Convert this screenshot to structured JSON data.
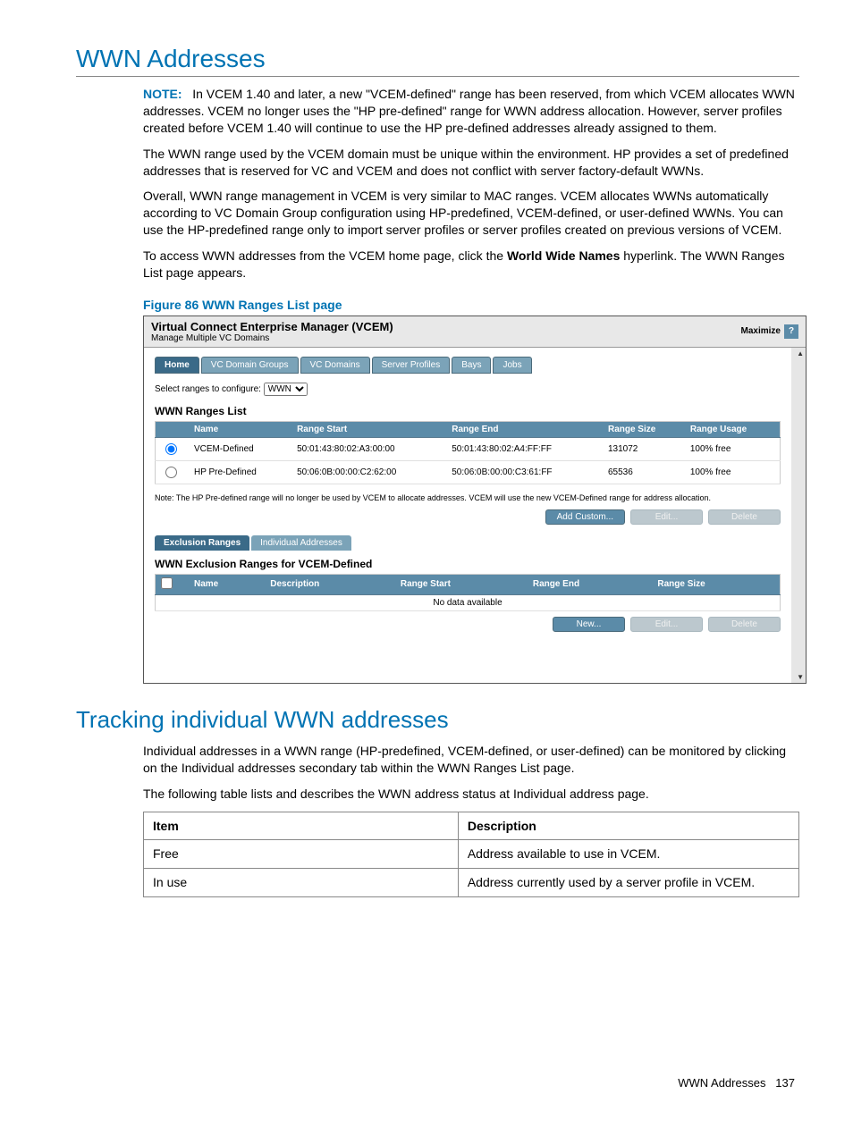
{
  "h1": "WWN Addresses",
  "note_label": "NOTE:",
  "para1": "In VCEM 1.40 and later, a new \"VCEM-defined\" range has been reserved, from which VCEM allocates WWN addresses. VCEM no longer uses the \"HP pre-defined\" range for WWN address allocation. However, server profiles created before VCEM 1.40 will continue to use the HP pre-defined addresses already assigned to them.",
  "para2": "The WWN range used by the VCEM domain must be unique within the environment. HP provides a set of predefined addresses that is reserved for VC and VCEM and does not conflict with server factory-default WWNs.",
  "para3": "Overall, WWN range management in VCEM is very similar to MAC ranges. VCEM allocates WWNs automatically according to VC Domain Group configuration using HP-predefined, VCEM-defined, or user-defined WWNs. You can use the HP-predefined range only to import server profiles or server profiles created on previous versions of VCEM.",
  "para4_a": "To access WWN addresses from the VCEM home page, click the ",
  "para4_bold": "World Wide Names",
  "para4_b": " hyperlink. The WWN Ranges List page appears.",
  "fig_caption": "Figure 86 WWN Ranges List page",
  "ss": {
    "title": "Virtual Connect Enterprise Manager (VCEM)",
    "subtitle": "Manage Multiple VC Domains",
    "maximize": "Maximize",
    "help": "?",
    "tabs": [
      "Home",
      "VC Domain Groups",
      "VC Domains",
      "Server Profiles",
      "Bays",
      "Jobs"
    ],
    "select_label": "Select ranges to configure:",
    "select_value": "WWN",
    "list_title": "WWN Ranges List",
    "cols": [
      "",
      "Name",
      "Range Start",
      "Range End",
      "Range Size",
      "Range Usage"
    ],
    "rows": [
      {
        "sel": true,
        "name": "VCEM-Defined",
        "start": "50:01:43:80:02:A3:00:00",
        "end": "50:01:43:80:02:A4:FF:FF",
        "size": "131072",
        "usage": "100% free"
      },
      {
        "sel": false,
        "name": "HP Pre-Defined",
        "start": "50:06:0B:00:00:C2:62:00",
        "end": "50:06:0B:00:00:C3:61:FF",
        "size": "65536",
        "usage": "100% free"
      }
    ],
    "note": "Note: The HP Pre-defined range will no longer be used by VCEM to allocate addresses. VCEM will use the new VCEM-Defined range for address allocation.",
    "btns1": [
      {
        "label": "Add Custom...",
        "enabled": true
      },
      {
        "label": "Edit...",
        "enabled": false
      },
      {
        "label": "Delete",
        "enabled": false
      }
    ],
    "subtabs": [
      "Exclusion Ranges",
      "Individual Addresses"
    ],
    "ex_title": "WWN Exclusion Ranges for VCEM-Defined",
    "ex_cols": [
      "",
      "Name",
      "Description",
      "Range Start",
      "Range End",
      "Range Size"
    ],
    "no_data": "No data available",
    "btns2": [
      {
        "label": "New...",
        "enabled": true
      },
      {
        "label": "Edit...",
        "enabled": false
      },
      {
        "label": "Delete",
        "enabled": false
      }
    ]
  },
  "h2": "Tracking individual WWN addresses",
  "para5": "Individual addresses in a WWN range (HP-predefined, VCEM-defined, or user-defined) can be monitored by clicking on the Individual addresses secondary tab within the WWN Ranges List page.",
  "para6": "The following table lists and describes the WWN address status at Individual address page.",
  "status_table": {
    "headers": [
      "Item",
      "Description"
    ],
    "rows": [
      [
        "Free",
        "Address available to use in VCEM."
      ],
      [
        "In use",
        "Address currently used by a server profile in VCEM."
      ]
    ]
  },
  "footer_text": "WWN Addresses",
  "footer_page": "137"
}
